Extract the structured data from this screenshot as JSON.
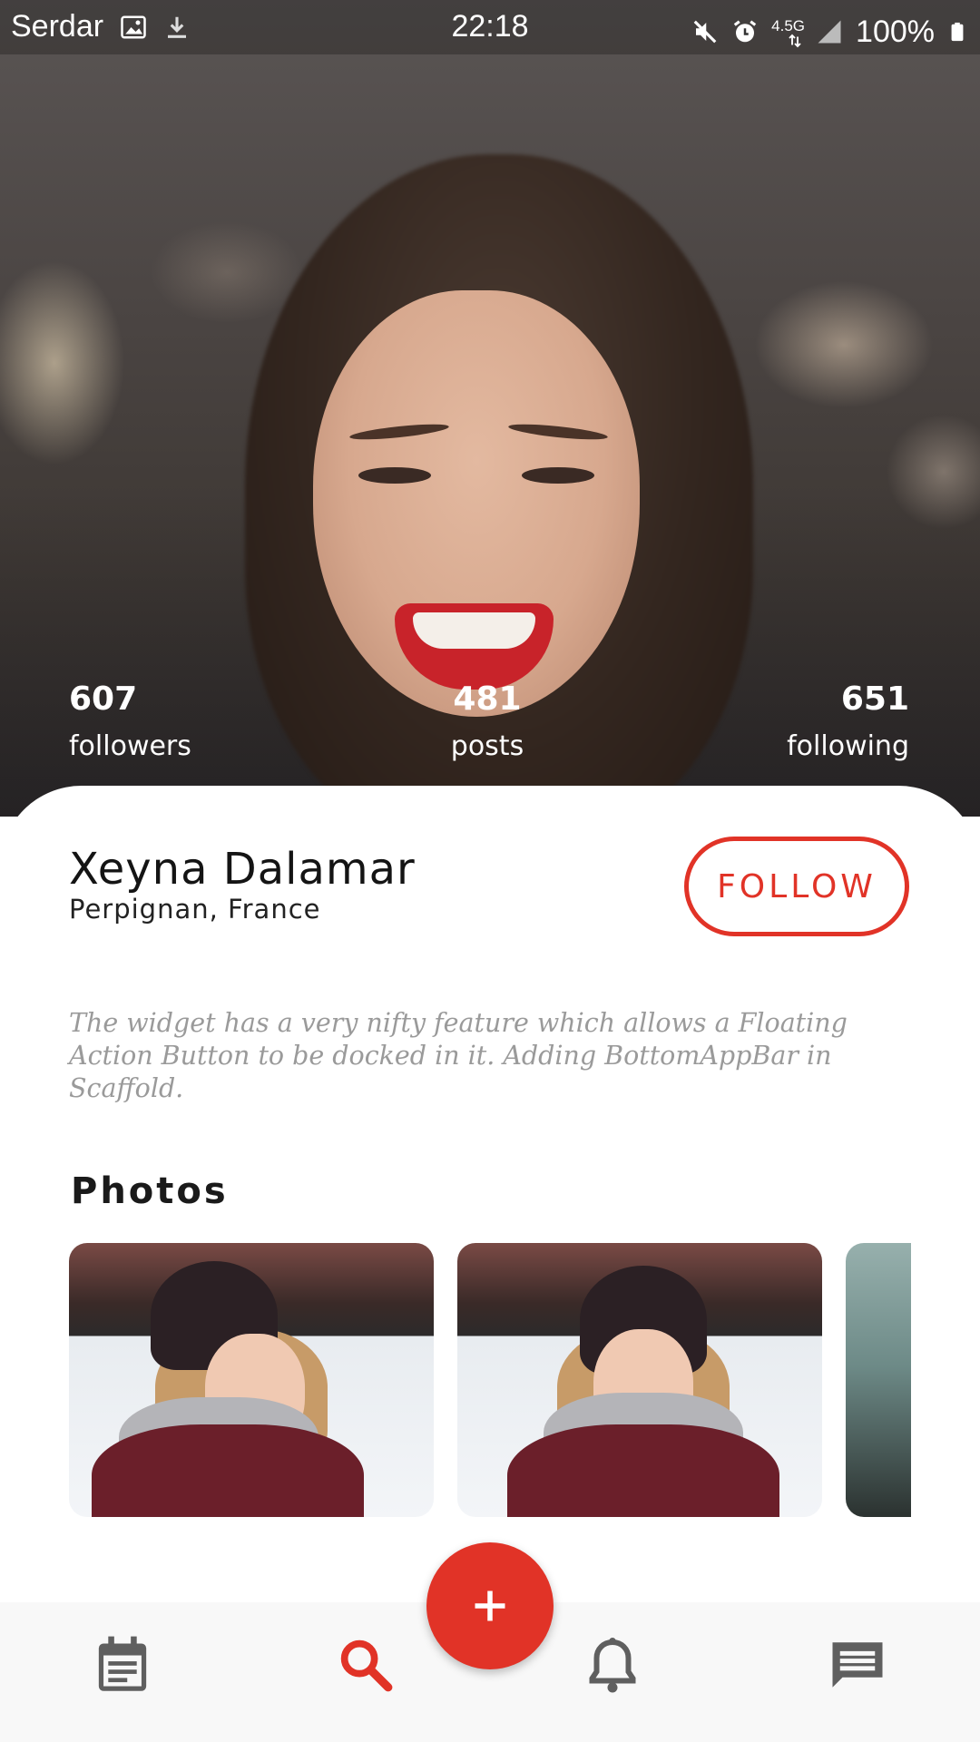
{
  "status_bar": {
    "carrier": "Serdar",
    "time": "22:18",
    "network": "4.5G",
    "battery": "100%",
    "icons": [
      "image-icon",
      "download-icon",
      "mute-icon",
      "alarm-icon",
      "data-arrows-icon",
      "signal-icon",
      "battery-icon"
    ]
  },
  "stats": {
    "followers": {
      "value": "607",
      "label": "followers"
    },
    "posts": {
      "value": "481",
      "label": "posts"
    },
    "following": {
      "value": "651",
      "label": "following"
    }
  },
  "profile": {
    "name": "Xeyna Dalamar",
    "location": "Perpignan, France",
    "follow_label": "FOLLOW",
    "bio": "The widget has a very nifty feature which allows a Floating Action Button to be docked in it. Adding BottomAppBar in Scaffold."
  },
  "photos": {
    "title": "Photos"
  },
  "bottom_nav": {
    "items": [
      {
        "icon": "calendar-icon",
        "active": false
      },
      {
        "icon": "search-icon",
        "active": true
      },
      {
        "icon": "bell-icon",
        "active": false
      },
      {
        "icon": "chat-icon",
        "active": false
      }
    ],
    "fab_icon": "plus-icon"
  },
  "colors": {
    "accent": "#e13327",
    "inactive_icon": "#5f5f5f",
    "text_primary": "#141414",
    "text_muted": "#9a9a9a"
  }
}
